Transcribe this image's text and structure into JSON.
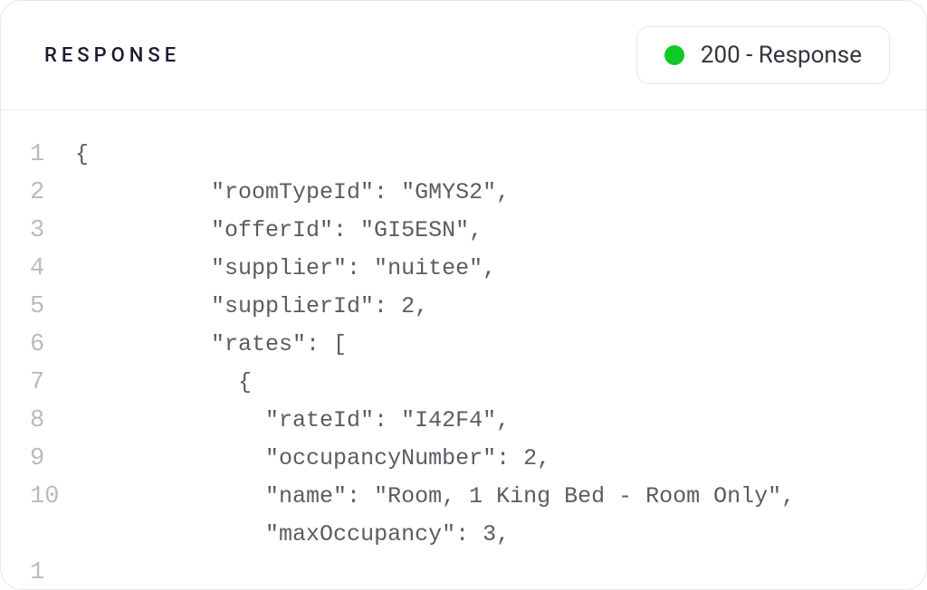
{
  "header": {
    "title": "RESPONSE",
    "status_code_text": "200 - Response",
    "status_ok": true
  },
  "code": {
    "lines": [
      {
        "num": "1",
        "text": "{"
      },
      {
        "num": "2",
        "text": "          \"roomTypeId\": \"GMYS2\","
      },
      {
        "num": "3",
        "text": "          \"offerId\": \"GI5ESN\","
      },
      {
        "num": "4",
        "text": "          \"supplier\": \"nuitee\","
      },
      {
        "num": "5",
        "text": "          \"supplierId\": 2,"
      },
      {
        "num": "6",
        "text": "          \"rates\": ["
      },
      {
        "num": "7",
        "text": "            {"
      },
      {
        "num": "8",
        "text": "              \"rateId\": \"I42F4\","
      },
      {
        "num": "9",
        "text": "              \"occupancyNumber\": 2,"
      },
      {
        "num": "10",
        "text": "              \"name\": \"Room, 1 King Bed - Room Only\","
      },
      {
        "num": "1",
        "text": "              \"maxOccupancy\": 3,"
      }
    ]
  },
  "response_payload": {
    "roomTypeId": "GMYS2",
    "offerId": "GI5ESN",
    "supplier": "nuitee",
    "supplierId": 2,
    "rates": [
      {
        "rateId": "I42F4",
        "occupancyNumber": 2,
        "name": "Room, 1 King Bed - Room Only",
        "maxOccupancy": 3
      }
    ]
  }
}
